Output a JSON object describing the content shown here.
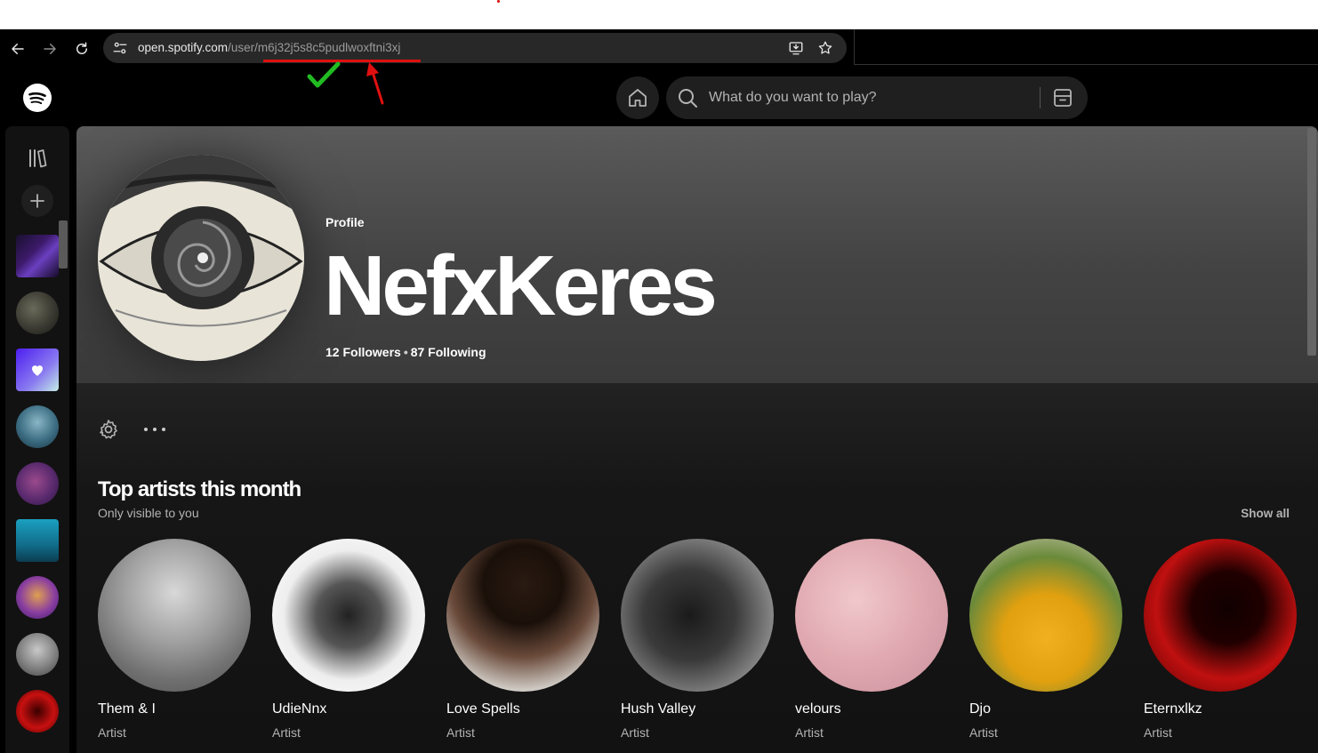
{
  "browser": {
    "url_host": "open.spotify.com",
    "url_path": "/user/m6j32j5s8c5pudlwoxftni3xj"
  },
  "search": {
    "placeholder": "What do you want to play?"
  },
  "profile": {
    "label": "Profile",
    "name": "NefxKeres",
    "followers": "12 Followers",
    "separator": "•",
    "following": "87 Following"
  },
  "top_artists": {
    "title": "Top artists this month",
    "subtitle": "Only visible to you",
    "show_all": "Show all",
    "items": [
      {
        "name": "Them & I",
        "kind": "Artist"
      },
      {
        "name": "UdieNnx",
        "kind": "Artist"
      },
      {
        "name": "Love Spells",
        "kind": "Artist"
      },
      {
        "name": "Hush Valley",
        "kind": "Artist"
      },
      {
        "name": "velours",
        "kind": "Artist"
      },
      {
        "name": "Djo",
        "kind": "Artist"
      },
      {
        "name": "Eternxlkz",
        "kind": "Artist"
      }
    ]
  },
  "colors": {
    "annotation_red": "#e01010",
    "annotation_green": "#22bb22",
    "spotify_bg": "#121212"
  }
}
